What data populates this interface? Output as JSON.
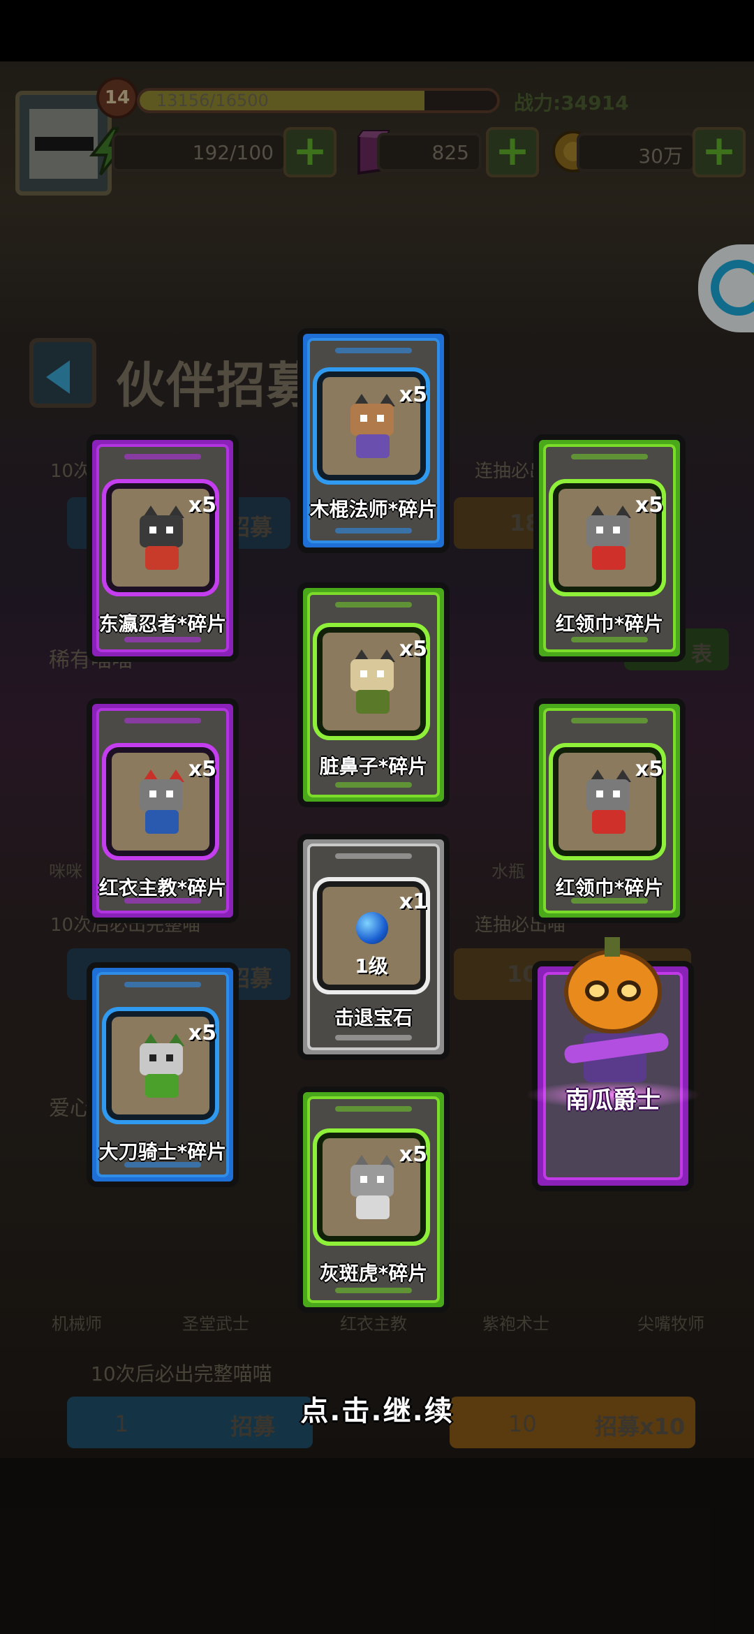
{
  "hud": {
    "level": "14",
    "xp_text": "13156/16500",
    "xp_progress": 0.797,
    "power_text": "战力:34914",
    "stamina": "192/100",
    "gems": "825",
    "coins": "30万"
  },
  "page": {
    "title": "伙伴招募"
  },
  "background": {
    "line1_left": "10次后必出完整喵",
    "line1_right": "连抽必出喵",
    "recruit_btn": "招募",
    "gem_cost": "188",
    "rare_title": "稀有喵喵",
    "pool_btn": "表",
    "char_left": "咪咪",
    "char_right": "水瓶",
    "line2_left": "10次后必出完整喵",
    "line2_right": "连抽必出喵",
    "recruit_btn2": "招募",
    "ticket_cost2": "10",
    "love_title": "爱心",
    "bottom_chars": [
      "机械师",
      "圣堂武士",
      "红衣主教",
      "紫袍术士",
      "尖嘴牧师"
    ],
    "line3": "10次后必出完整喵喵",
    "ticket_single": "1",
    "recruit_single": "招募",
    "ticket_ten": "10",
    "recruit_ten": "招募x10"
  },
  "rewards": [
    {
      "name": "木棍法师*碎片",
      "count": "x5",
      "rarity": "blue"
    },
    {
      "name": "东瀛忍者*碎片",
      "count": "x5",
      "rarity": "purple"
    },
    {
      "name": "红领巾*碎片",
      "count": "x5",
      "rarity": "green"
    },
    {
      "name": "脏鼻子*碎片",
      "count": "x5",
      "rarity": "green"
    },
    {
      "name": "红衣主教*碎片",
      "count": "x5",
      "rarity": "purple"
    },
    {
      "name": "红领巾*碎片",
      "count": "x5",
      "rarity": "green"
    },
    {
      "name": "击退宝石",
      "count": "x1",
      "level": "1级",
      "rarity": "white"
    },
    {
      "name": "大刀骑士*碎片",
      "count": "x5",
      "rarity": "blue"
    },
    {
      "name": "灰斑虎*碎片",
      "count": "x5",
      "rarity": "green"
    }
  ],
  "featured": {
    "name": "南瓜爵士",
    "rarity": "purple"
  },
  "continue_text": "点.击.继.续",
  "colors": {
    "blue": "#1e6fd6",
    "purple": "#8a21b8",
    "green": "#4aa91a",
    "white": "#8e8e8e"
  }
}
